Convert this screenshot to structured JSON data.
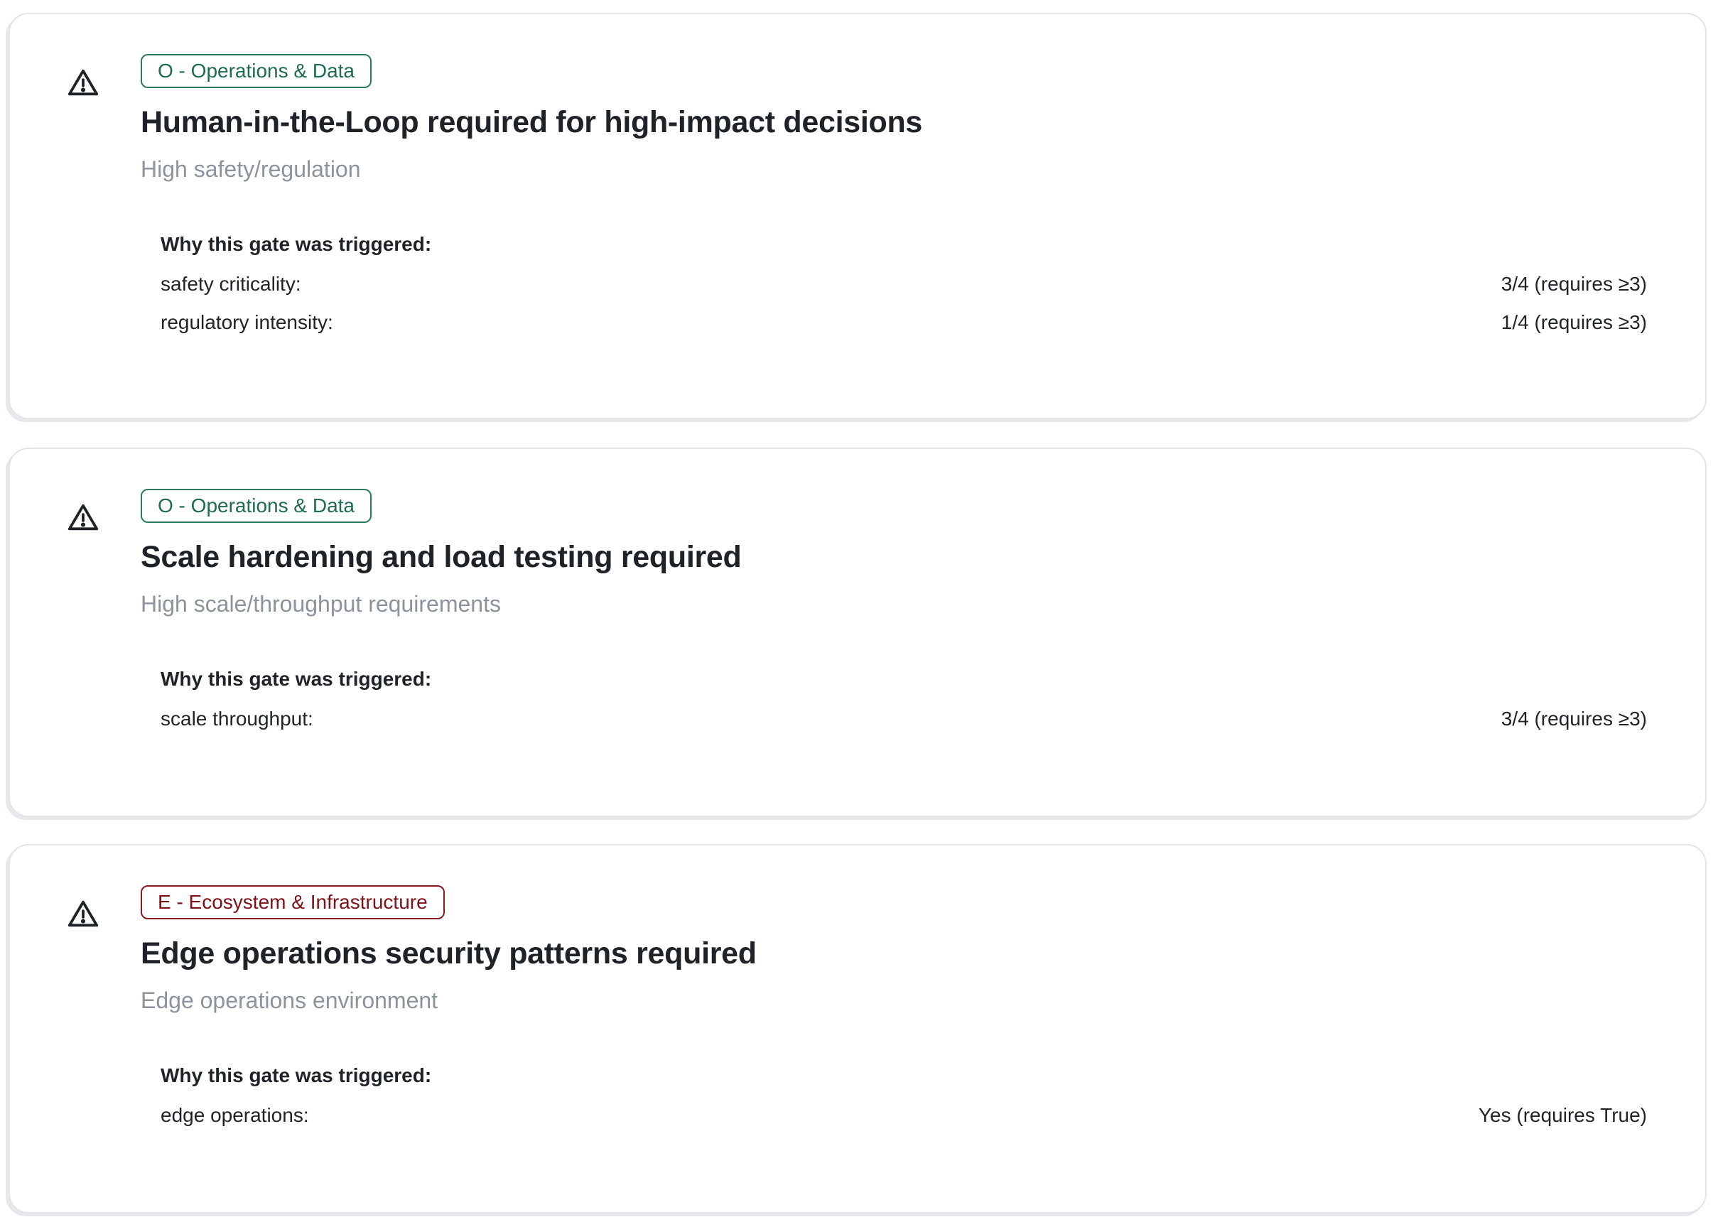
{
  "gates": [
    {
      "icon": "warning-triangle-icon",
      "category": "O - Operations & Data",
      "category_color": "#2d7a5c",
      "title": "Human-in-the-Loop required for high-impact decisions",
      "subtitle": "High safety/regulation",
      "why_heading": "Why this gate was triggered:",
      "criteria": [
        {
          "label": "safety criticality:",
          "value": "3/4 (requires ≥3)"
        },
        {
          "label": "regulatory intensity:",
          "value": "1/4 (requires ≥3)"
        }
      ]
    },
    {
      "icon": "warning-triangle-icon",
      "category": "O - Operations & Data",
      "category_color": "#2d7a5c",
      "title": "Scale hardening and load testing required",
      "subtitle": "High scale/throughput requirements",
      "why_heading": "Why this gate was triggered:",
      "criteria": [
        {
          "label": "scale throughput:",
          "value": "3/4 (requires ≥3)"
        }
      ]
    },
    {
      "icon": "warning-triangle-icon",
      "category": "E - Ecosystem & Infrastructure",
      "category_color": "#8a1a22",
      "title": "Edge operations security patterns required",
      "subtitle": "Edge operations environment",
      "why_heading": "Why this gate was triggered:",
      "criteria": [
        {
          "label": "edge operations:",
          "value": "Yes (requires True)"
        }
      ]
    }
  ]
}
